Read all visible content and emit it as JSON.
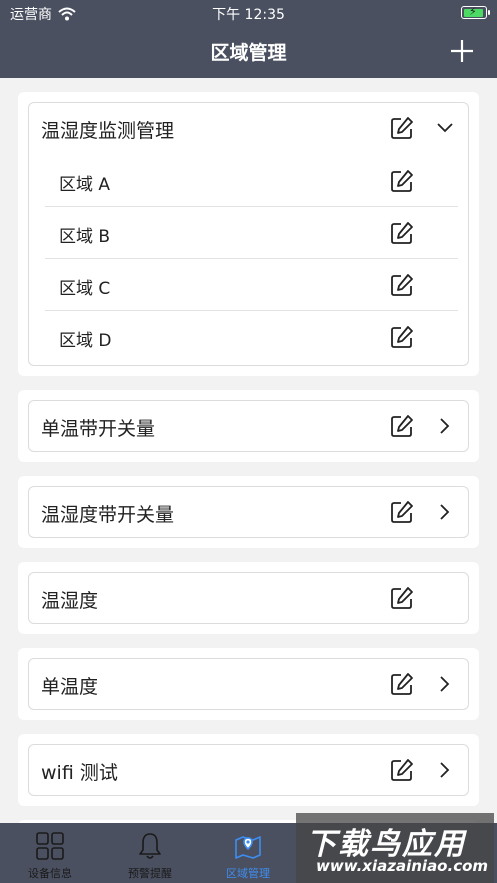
{
  "status_bar": {
    "carrier": "运营商",
    "time": "下午 12:35"
  },
  "nav": {
    "title": "区域管理",
    "add_icon": "plus-icon"
  },
  "groups": [
    {
      "label": "温湿度监测管理",
      "expanded": true,
      "children": [
        {
          "label": "区域 A"
        },
        {
          "label": "区域 B"
        },
        {
          "label": "区域 C"
        },
        {
          "label": "区域 D"
        }
      ]
    },
    {
      "label": "单温带开关量",
      "expanded": false,
      "has_chevron": true
    },
    {
      "label": "温湿度带开关量",
      "expanded": false,
      "has_chevron": true
    },
    {
      "label": "温湿度",
      "expanded": false,
      "has_chevron": false
    },
    {
      "label": "单温度",
      "expanded": false,
      "has_chevron": true
    },
    {
      "label": "wifi 测试",
      "expanded": false,
      "has_chevron": true
    }
  ],
  "tabs": [
    {
      "label": "设备信息",
      "icon": "grid-icon",
      "active": false
    },
    {
      "label": "预警提醒",
      "icon": "bell-icon",
      "active": false
    },
    {
      "label": "区域管理",
      "icon": "map-pin-icon",
      "active": true
    }
  ],
  "colors": {
    "header": "#4a5060",
    "active_tab": "#3d8ef2",
    "battery": "#4cd964"
  },
  "watermark": {
    "big": "下载鸟应用",
    "small": "www.xiazainiao.com"
  }
}
